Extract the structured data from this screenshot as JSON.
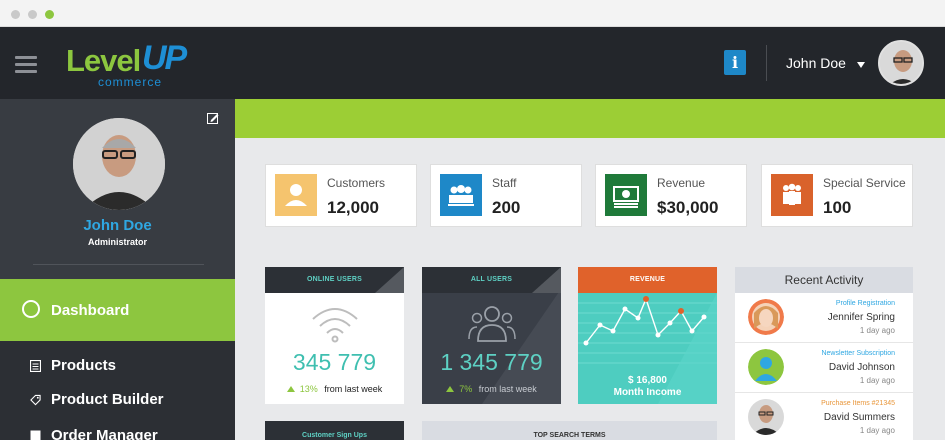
{
  "brand": {
    "logo_level": "Level",
    "logo_up": "UP",
    "logo_commerce": "commerce",
    "colors": {
      "green": "#8dc63f",
      "blue": "#1e8fd5",
      "dark": "#23262b"
    }
  },
  "header": {
    "user_name": "John Doe",
    "info_label": "i"
  },
  "sidebar": {
    "profile_name": "John Doe",
    "profile_role": "Administrator",
    "active_item": {
      "label": "Dashboard",
      "icon": "dashboard-icon"
    },
    "items": [
      {
        "label": "Products",
        "icon": "products-icon"
      },
      {
        "label": "Product Builder",
        "icon": "tag-icon"
      },
      {
        "label": "Order Manager",
        "icon": "order-icon"
      }
    ]
  },
  "stats": [
    {
      "label": "Customers",
      "value": "12,000",
      "icon": "customer-icon",
      "color": "#f5c46e"
    },
    {
      "label": "Staff",
      "value": "200",
      "icon": "staff-icon",
      "color": "#1e88c8"
    },
    {
      "label": "Revenue",
      "value": "$30,000",
      "icon": "money-icon",
      "color": "#1f7a3a"
    },
    {
      "label": "Special Service",
      "value": "100",
      "icon": "group-icon",
      "color": "#d9622b"
    }
  ],
  "cards": {
    "online_users": {
      "title": "ONLINE USERS",
      "value": "345 779",
      "change": "13%",
      "change_suffix": "from last week"
    },
    "all_users": {
      "title": "ALL USERS",
      "value": "1 345 779",
      "change": "7%",
      "change_suffix": "from last week"
    },
    "revenue": {
      "title": "REVENUE",
      "amount": "$ 16,800",
      "caption": "Month Income"
    }
  },
  "activity": {
    "title": "Recent Activity",
    "items": [
      {
        "type": "Profile Registration",
        "name": "Jennifer Spring",
        "time": "1 day ago",
        "type_color": "#2fa7e2"
      },
      {
        "type": "Newsletter Subscription",
        "name": "David Johnson",
        "time": "1 day ago",
        "type_color": "#2fa7e2"
      },
      {
        "type": "Purchase Items #21345",
        "name": "David Summers",
        "time": "1 day ago",
        "type_color": "#e8963a"
      }
    ]
  },
  "bottom": {
    "customer_signups": "Customer Sign Ups",
    "top_search": "TOP SEARCH TERMS"
  }
}
